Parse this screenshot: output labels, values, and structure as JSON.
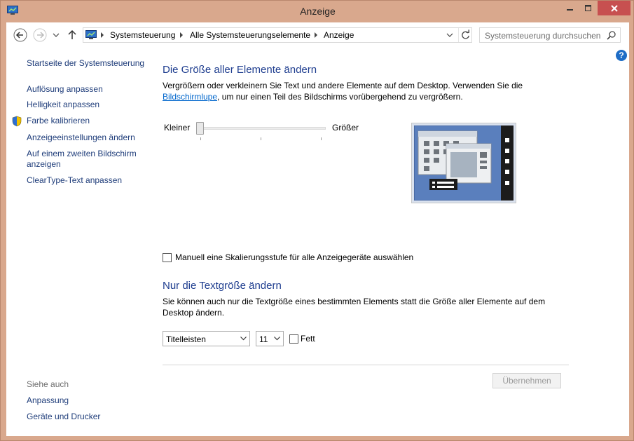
{
  "window": {
    "title": "Anzeige"
  },
  "address": {
    "crumbs": [
      "Systemsteuerung",
      "Alle Systemsteuerungselemente",
      "Anzeige"
    ]
  },
  "search": {
    "placeholder": "Systemsteuerung durchsuchen"
  },
  "help": {
    "glyph": "?"
  },
  "sidebar": {
    "home": "Startseite der Systemsteuerung",
    "items": [
      "Auflösung anpassen",
      "Helligkeit anpassen",
      "Farbe kalibrieren",
      "Anzeigeeinstellungen ändern",
      "Auf einem zweiten Bildschirm",
      "anzeigen",
      "ClearType-Text anpassen"
    ],
    "see_also": {
      "heading": "Siehe auch",
      "links": [
        "Anpassung",
        "Geräte und Drucker"
      ]
    }
  },
  "size_section": {
    "title": "Die Größe aller Elemente ändern",
    "desc_line1": "Vergrößern oder verkleinern Sie Text und andere Elemente auf dem Desktop. Verwenden Sie die",
    "desc_link": "Bildschirmlupe",
    "desc_line2_rest": ", um nur einen Teil des Bildschirms vorübergehend zu vergrößern.",
    "slider_min_label": "Kleiner",
    "slider_max_label": "Größer",
    "slider_level": 0,
    "manual_checkbox_label": "Manuell eine Skalierungsstufe für alle Anzeigegeräte auswählen",
    "manual_checked": false
  },
  "text_section": {
    "title": "Nur die Textgröße ändern",
    "desc_line1": "Sie können auch nur die Textgröße eines bestimmten Elements statt die Größe aller Elemente auf dem",
    "desc_line2": "Desktop ändern.",
    "element_value": "Titelleisten",
    "size_value": "11",
    "bold_label": "Fett",
    "bold_checked": false
  },
  "apply_label": "Übernehmen",
  "colors": {
    "window_frame": "#d9a88d",
    "close_button": "#c75050",
    "heading": "#1e3d8f",
    "link": "#1f3d7a",
    "preview_screen": "#5a7fbd"
  }
}
